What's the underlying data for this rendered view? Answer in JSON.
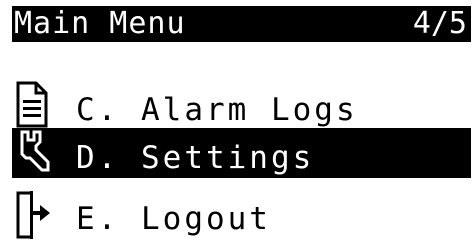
{
  "header": {
    "title": "Main Menu",
    "page_indicator": "4/5"
  },
  "menu": {
    "items": [
      {
        "label": "C. Alarm Logs",
        "icon": "document-icon",
        "selected": false
      },
      {
        "label": "D. Settings",
        "icon": "wrench-icon",
        "selected": true
      },
      {
        "label": "E. Logout",
        "icon": "logout-icon",
        "selected": false
      }
    ]
  },
  "colors": {
    "background": "#ffffff",
    "foreground": "#000000",
    "highlight": "#000000",
    "highlight_text": "#ffffff"
  }
}
